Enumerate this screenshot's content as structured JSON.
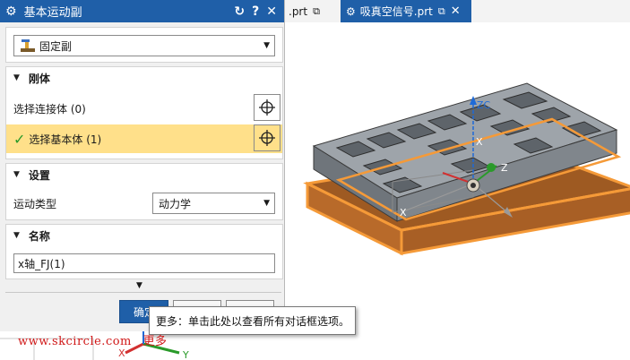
{
  "dialog": {
    "title": "基本运动副",
    "tools": {
      "reset": "↻",
      "help": "?",
      "close": "✕"
    }
  },
  "joint_type": {
    "selected": "固定副"
  },
  "rigid_body": {
    "header": "刚体",
    "select_link_label": "选择连接体 (0)",
    "select_base_label": "选择基本体 (1)"
  },
  "settings": {
    "header": "设置",
    "motion_type_label": "运动类型",
    "motion_type_value": "动力学"
  },
  "name": {
    "header": "名称",
    "value": "x轴_FJ(1)"
  },
  "buttons": {
    "ok": "确定",
    "apply": "",
    "cancel": ""
  },
  "tooltip": "更多：单击此处以查看所有对话框选项。",
  "tabs": [
    {
      "label": ".prt"
    },
    {
      "label": "吸真空信号.prt"
    }
  ],
  "viewport_labels": {
    "zc": "ZC",
    "x": "X",
    "z": "Z",
    "y": "Y"
  },
  "watermark": "www.skcircle.com",
  "watermark_suffix": "更多",
  "colors": {
    "accent": "#1f5fa8",
    "highlight_row": "#ffe08a",
    "check": "#2a9a2a",
    "selection_orange": "#f59a38",
    "watermark": "#d01818"
  }
}
